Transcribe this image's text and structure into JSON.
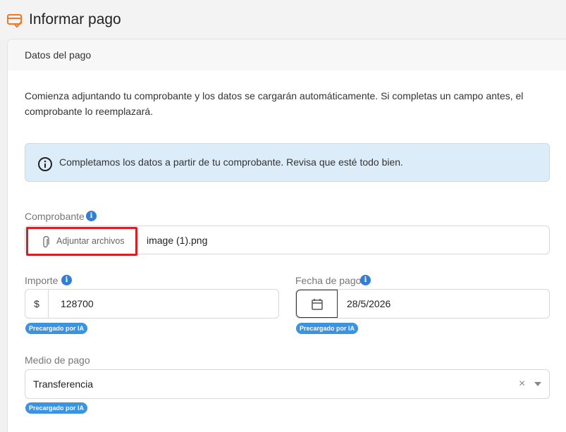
{
  "page": {
    "title": "Informar pago"
  },
  "section": {
    "title": "Datos del pago"
  },
  "intro": "Comienza adjuntando tu comprobante y los datos se cargarán automáticamente. Si completas un campo antes, el comprobante lo reemplazará.",
  "alert": {
    "text": "Completamos los datos a partir de tu comprobante. Revisa que esté todo bien."
  },
  "comprobante": {
    "label": "Comprobante",
    "attach_label": "Adjuntar archivos",
    "file_name": "image (1).png"
  },
  "importe": {
    "label": "Importe",
    "prefix": "$",
    "value": "128700",
    "badge": "Precargado por IA"
  },
  "fecha": {
    "label": "Fecha de pago",
    "value": "28/5/2026",
    "badge": "Precargado por IA"
  },
  "medio": {
    "label": "Medio de pago",
    "value": "Transferencia",
    "clear": "×",
    "badge": "Precargado por IA"
  },
  "info_glyph": "i",
  "colors": {
    "accent": "#2f7fd8",
    "highlight_border": "#d91f26",
    "badge": "#3b93e3",
    "alert_bg": "#dcedf9",
    "brand_icon": "#f07a22"
  }
}
